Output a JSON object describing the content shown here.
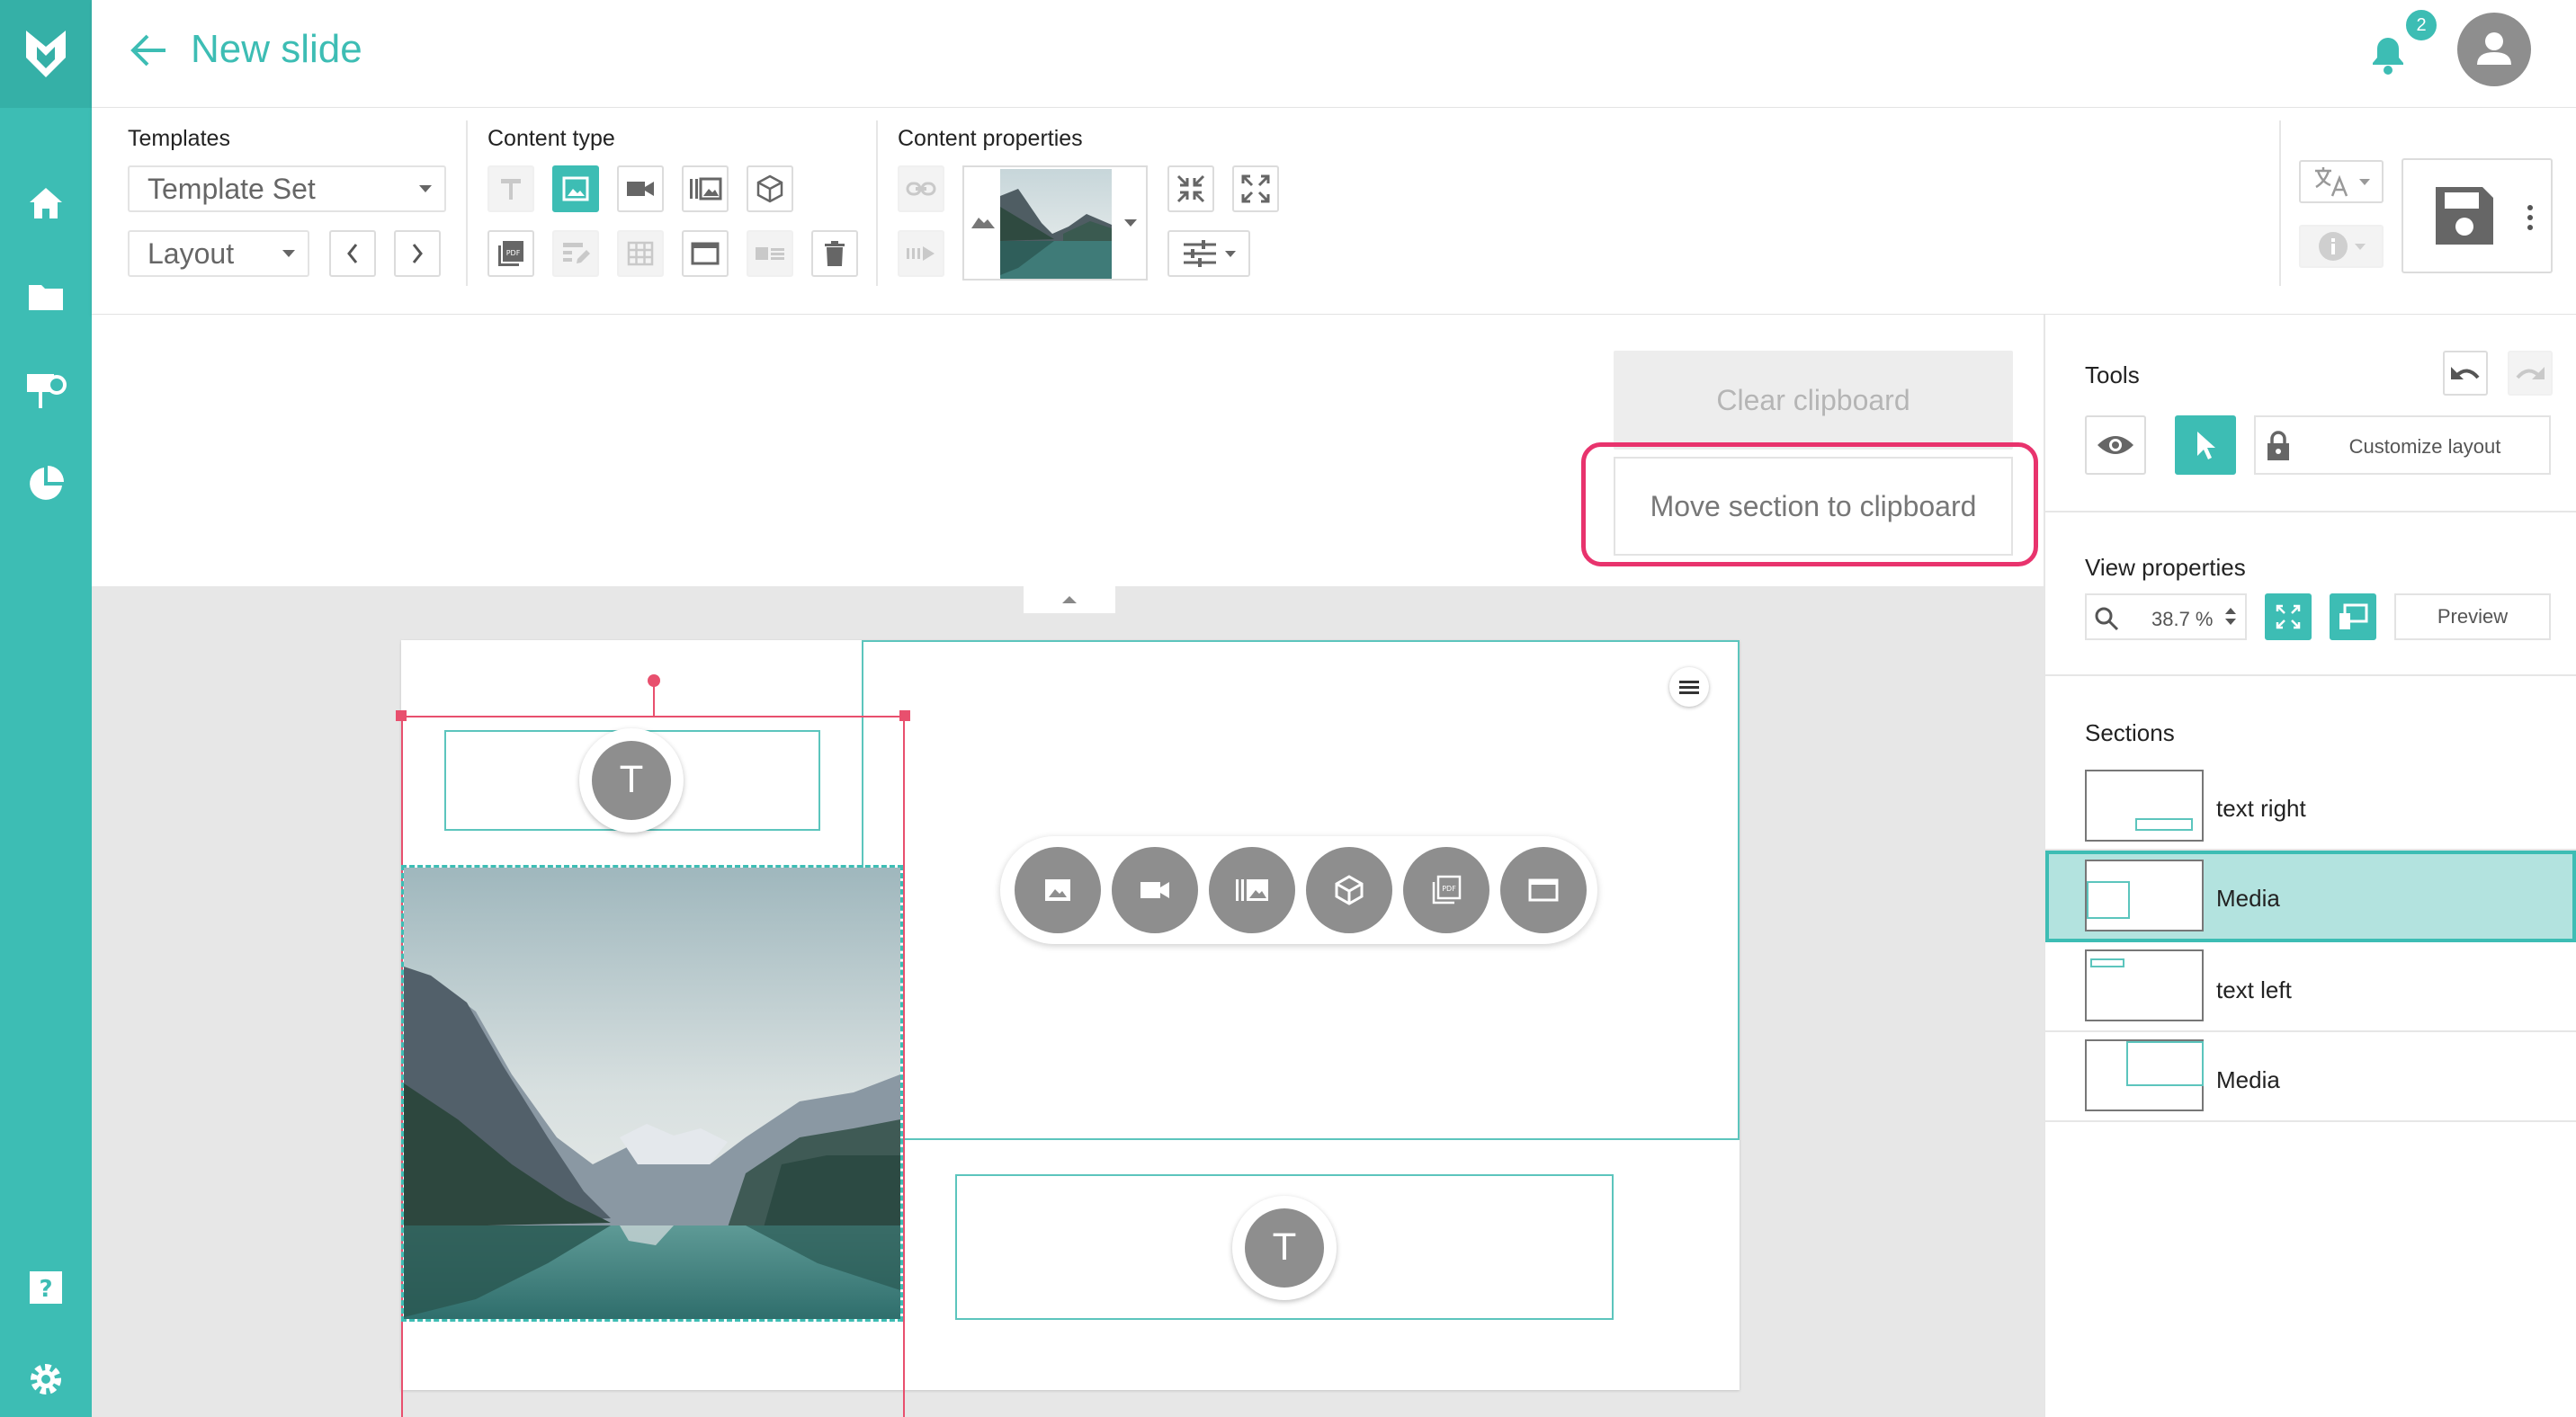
{
  "header": {
    "title": "New slide",
    "notification_count": "2"
  },
  "sidebar": {
    "items": [
      {
        "name": "home",
        "icon": "home-icon"
      },
      {
        "name": "folder",
        "icon": "folder-icon"
      },
      {
        "name": "presentation",
        "icon": "presentation-icon"
      },
      {
        "name": "analytics",
        "icon": "pie-chart-icon"
      },
      {
        "name": "help",
        "icon": "help-icon"
      },
      {
        "name": "settings",
        "icon": "gear-icon"
      }
    ]
  },
  "toolbar": {
    "templates_label": "Templates",
    "template_set_value": "Template Set",
    "layout_value": "Layout",
    "content_type_label": "Content type",
    "content_properties_label": "Content properties"
  },
  "clipboard": {
    "clear_label": "Clear clipboard",
    "move_label": "Move section to clipboard"
  },
  "slide": {
    "text_placeholder": "T"
  },
  "panel": {
    "tools_label": "Tools",
    "customize_layout_label": "Customize layout",
    "view_properties_label": "View properties",
    "zoom_value": "38.7 %",
    "preview_label": "Preview",
    "sections_label": "Sections",
    "sections": [
      {
        "label": "text right"
      },
      {
        "label": "Media"
      },
      {
        "label": "text left"
      },
      {
        "label": "Media"
      }
    ]
  },
  "colors": {
    "brand": "#3dbdb4",
    "highlight": "#e8336d",
    "selection": "#e8506e"
  }
}
